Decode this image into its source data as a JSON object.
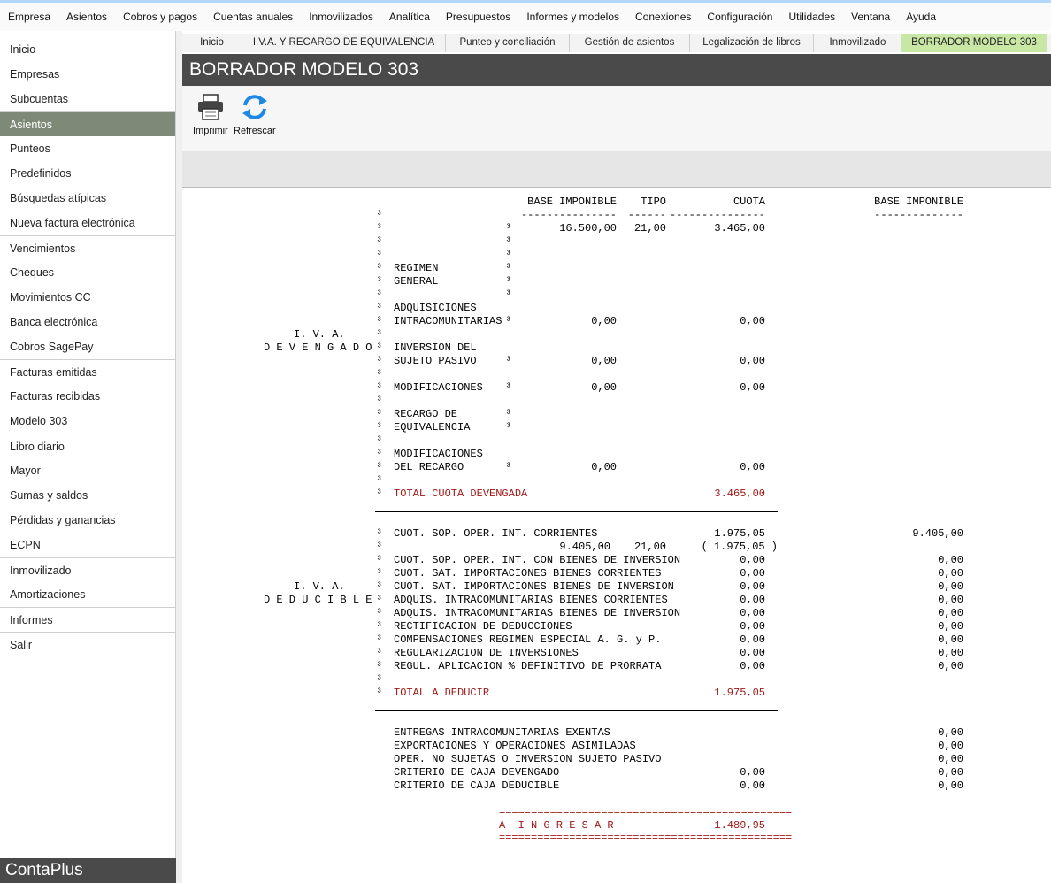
{
  "menubar": {
    "items": [
      "Empresa",
      "Asientos",
      "Cobros y pagos",
      "Cuentas anuales",
      "Inmovilizados",
      "Analítica",
      "Presupuestos",
      "Informes y modelos",
      "Conexiones",
      "Configuración",
      "Utilidades",
      "Ventana",
      "Ayuda"
    ]
  },
  "sidebar": {
    "items": [
      {
        "label": "Inicio",
        "sep": false
      },
      {
        "label": "Empresas",
        "sep": false
      },
      {
        "label": "Subcuentas",
        "sep": false
      },
      {
        "label": "Asientos",
        "sep": true,
        "active": true
      },
      {
        "label": "Punteos",
        "sep": false
      },
      {
        "label": "Predefinidos",
        "sep": false
      },
      {
        "label": "Búsquedas atípicas",
        "sep": false
      },
      {
        "label": "Nueva factura electrónica",
        "sep": false
      },
      {
        "label": "Vencimientos",
        "sep": true
      },
      {
        "label": "Cheques",
        "sep": false
      },
      {
        "label": "Movimientos CC",
        "sep": false
      },
      {
        "label": "Banca electrónica",
        "sep": false
      },
      {
        "label": "Cobros SagePay",
        "sep": false
      },
      {
        "label": "Facturas emitidas",
        "sep": true
      },
      {
        "label": "Facturas recibidas",
        "sep": false
      },
      {
        "label": "Modelo 303",
        "sep": false
      },
      {
        "label": "Libro diario",
        "sep": true
      },
      {
        "label": "Mayor",
        "sep": false
      },
      {
        "label": "Sumas y saldos",
        "sep": false
      },
      {
        "label": "Pérdidas y ganancias",
        "sep": false
      },
      {
        "label": "ECPN",
        "sep": false
      },
      {
        "label": "Inmovilizado",
        "sep": true
      },
      {
        "label": "Amortizaciones",
        "sep": false
      },
      {
        "label": "Informes",
        "sep": true
      },
      {
        "label": "Salir",
        "sep": true
      }
    ],
    "logo": "ContaPlus"
  },
  "tabs": [
    {
      "label": "Inicio"
    },
    {
      "label": "I.V.A. Y RECARGO DE EQUIVALENCIA"
    },
    {
      "label": "Punteo y conciliación"
    },
    {
      "label": "Gestión de asientos"
    },
    {
      "label": "Legalización de libros"
    },
    {
      "label": "Inmovilizado"
    },
    {
      "label": "BORRADOR MODELO 303",
      "active": true
    }
  ],
  "page_title": "BORRADOR MODELO 303",
  "toolbar": {
    "print_label": "Imprimir",
    "refresh_label": "Refrescar"
  },
  "report": {
    "header": {
      "base": "BASE IMPONIBLE",
      "tipo": "TIPO",
      "cuota": "CUOTA",
      "base2": "BASE IMPONIBLE"
    },
    "devengado": {
      "label1": "I. V. A.",
      "label2": "D E V E N G A D O",
      "general_base": "16.500,00",
      "general_tipo": "21,00",
      "general_cuota": "3.465,00",
      "regimen1": "REGIMEN",
      "regimen2": "GENERAL",
      "adq1": "ADQUISICIONES",
      "adq2": "INTRACOMUNITARIAS",
      "adq_base": "0,00",
      "adq_cuota": "0,00",
      "inv1": "INVERSION DEL",
      "inv2": "SUJETO PASIVO",
      "inv_base": "0,00",
      "inv_cuota": "0,00",
      "mod": "MODIFICACIONES",
      "mod_base": "0,00",
      "mod_cuota": "0,00",
      "rec1": "RECARGO DE",
      "rec2": "EQUIVALENCIA",
      "modrec1": "MODIFICACIONES",
      "modrec2": "DEL RECARGO",
      "modrec_base": "0,00",
      "modrec_cuota": "0,00",
      "total_label": "TOTAL CUOTA DEVENGADA",
      "total_value": "3.465,00"
    },
    "deducible": {
      "label1": "I. V. A.",
      "label2": "D E D U C I B L E",
      "rows": [
        {
          "label": "CUOT. SOP. OPER. INT. CORRIENTES",
          "cuota": "1.975,05",
          "base2": "9.405,00"
        },
        {
          "label": "",
          "cuota": "( 1.975,05 )",
          "base2": ""
        },
        {
          "label": "CUOT. SOP. OPER. INT. CON BIENES DE INVERSION",
          "cuota": "0,00",
          "base2": "0,00"
        },
        {
          "label": "CUOT. SAT. IMPORTACIONES BIENES CORRIENTES",
          "cuota": "0,00",
          "base2": "0,00"
        },
        {
          "label": "CUOT. SAT. IMPORTACIONES BIENES DE INVERSION",
          "cuota": "0,00",
          "base2": "0,00"
        },
        {
          "label": "ADQUIS. INTRACOMUNITARIAS BIENES CORRIENTES",
          "cuota": "0,00",
          "base2": "0,00"
        },
        {
          "label": "ADQUIS. INTRACOMUNITARIAS BIENES DE INVERSION",
          "cuota": "0,00",
          "base2": "0,00"
        },
        {
          "label": "RECTIFICACION DE DEDUCCIONES",
          "cuota": "0,00",
          "base2": "0,00"
        },
        {
          "label": "COMPENSACIONES REGIMEN ESPECIAL A. G. y P.",
          "cuota": "0,00",
          "base2": "0,00"
        },
        {
          "label": "REGULARIZACION DE INVERSIONES",
          "cuota": "0,00",
          "base2": "0,00"
        },
        {
          "label": "REGUL. APLICACION % DEFINITIVO DE PRORRATA",
          "cuota": "0,00",
          "base2": "0,00"
        }
      ],
      "sub_base": "9.405,00",
      "sub_tipo": "21,00",
      "total_label": "TOTAL A DEDUCIR",
      "total_value": "1.975,05"
    },
    "others": [
      {
        "label": "ENTREGAS INTRACOMUNITARIAS EXENTAS",
        "cuota": "",
        "base2": "0,00"
      },
      {
        "label": "EXPORTACIONES Y OPERACIONES ASIMILADAS",
        "cuota": "",
        "base2": "0,00"
      },
      {
        "label": "OPER. NO SUJETAS O INVERSION SUJETO PASIVO",
        "cuota": "",
        "base2": "0,00"
      },
      {
        "label": "CRITERIO DE CAJA DEVENGADO",
        "cuota": "0,00",
        "base2": "0,00"
      },
      {
        "label": "CRITERIO DE CAJA DEDUCIBLE",
        "cuota": "0,00",
        "base2": "0,00"
      }
    ],
    "result_label": "A  I N G R E S A R",
    "result_value": "1.489,95",
    "dashes_base": "---------------",
    "dashes_tipo": "------",
    "dashes_cuota": "---------------",
    "dashes_base2": "--------------",
    "equals": "==============================================",
    "vbar": "³"
  }
}
